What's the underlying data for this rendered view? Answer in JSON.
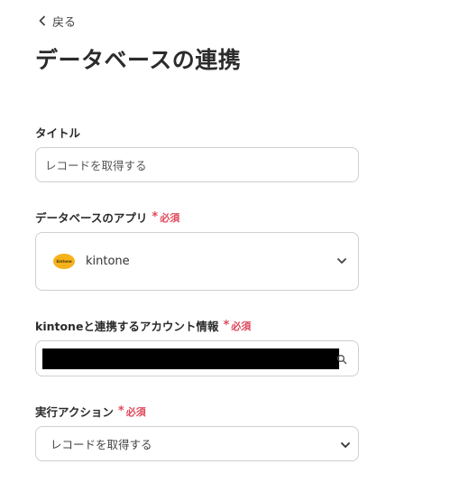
{
  "nav": {
    "back_label": "戻る"
  },
  "page": {
    "title": "データベースの連携"
  },
  "fields": {
    "title": {
      "label": "タイトル",
      "value": "レコードを取得する"
    },
    "database_app": {
      "label": "データベースのアプリ",
      "required": "必須",
      "selected": "kintone",
      "logo_text": "kintone"
    },
    "account": {
      "label": "kintoneと連携するアカウント情報",
      "required": "必須"
    },
    "action": {
      "label": "実行アクション",
      "required": "必須",
      "selected": "レコードを取得する"
    }
  },
  "colors": {
    "required": "#e0485a",
    "kintone_logo": "#f5b21c",
    "border": "#cfcfcf"
  }
}
